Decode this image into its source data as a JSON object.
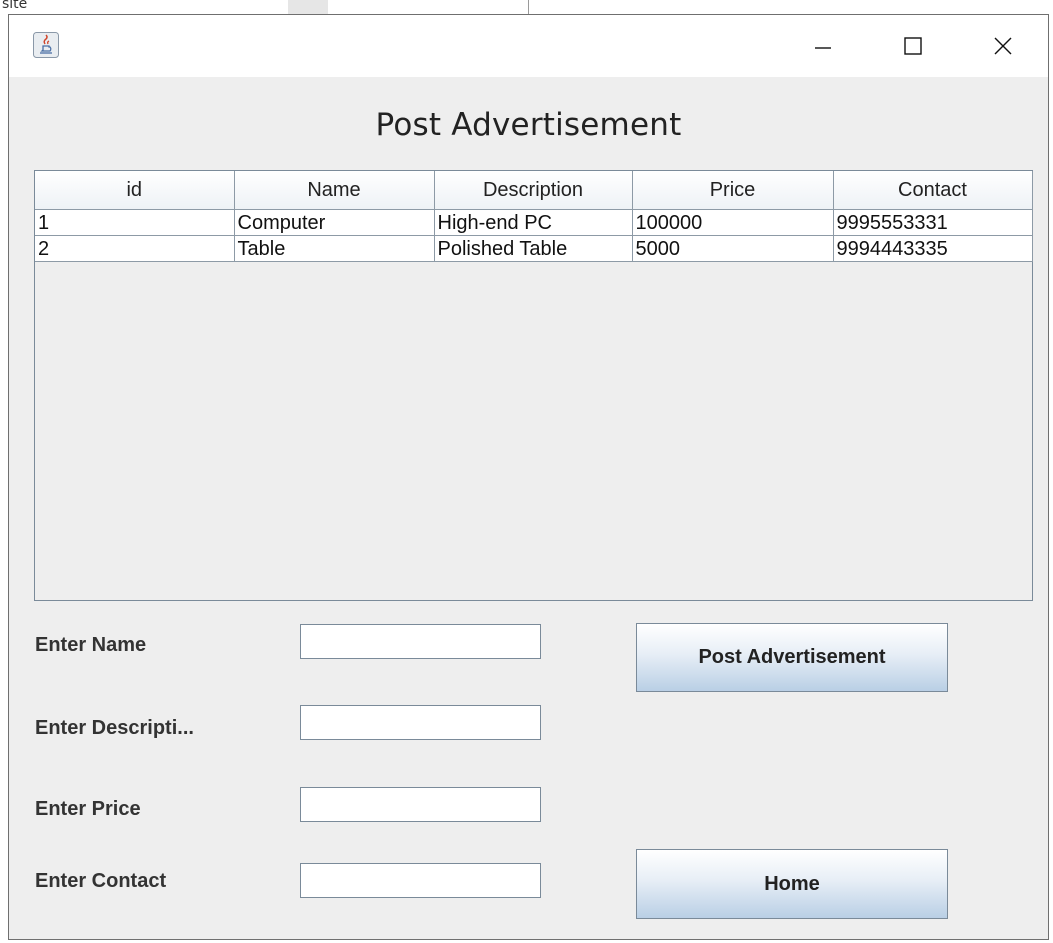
{
  "desktop": {
    "fragment_text": "site"
  },
  "window": {
    "title_label": "",
    "controls": {
      "minimize": "minimize-icon",
      "maximize": "maximize-icon",
      "close": "close-icon"
    }
  },
  "page": {
    "heading": "Post Advertisement"
  },
  "table": {
    "columns": [
      "id",
      "Name",
      "Description",
      "Price",
      "Contact"
    ],
    "rows": [
      [
        "1",
        "Computer",
        "High-end PC",
        "100000",
        "9995553331"
      ],
      [
        "2",
        "Table",
        "Polished Table",
        "5000",
        "9994443335"
      ]
    ]
  },
  "form": {
    "name_label": "Enter Name",
    "description_label": "Enter Descripti...",
    "price_label": "Enter Price",
    "contact_label": "Enter Contact",
    "name_value": "",
    "description_value": "",
    "price_value": "",
    "contact_value": ""
  },
  "buttons": {
    "post_label": "Post Advertisement",
    "home_label": "Home"
  },
  "colors": {
    "window_bg": "#eeeeee",
    "border": "#7a8a99",
    "button_gradient_end": "#b9cfe5"
  }
}
